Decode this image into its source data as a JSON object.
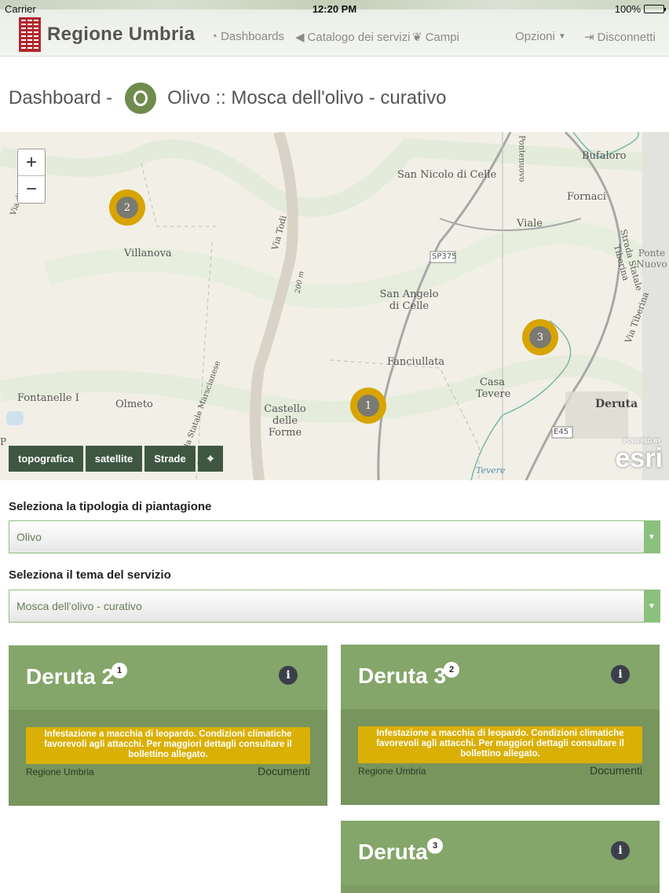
{
  "status_bar": {
    "carrier": "Carrier",
    "time": "12:20 PM",
    "battery": "100%"
  },
  "nav": {
    "brand": "Regione Umbria",
    "items": [
      {
        "label": "Dashboards",
        "icon": "dashboard-icon"
      },
      {
        "label": "Catalogo dei servizi",
        "icon": "megaphone-icon"
      },
      {
        "label": "Campi",
        "icon": "leaf-icon"
      },
      {
        "label": "Opzioni",
        "icon": "chevron-down-icon"
      },
      {
        "label": "Disconnetti",
        "icon": "logout-icon"
      }
    ]
  },
  "page": {
    "title_prefix": "Dashboard -",
    "title_main": "Olivo :: Mosca dell'olivo - curativo"
  },
  "map": {
    "zoom_in": "+",
    "zoom_out": "−",
    "labels": [
      "San Nicolo di Celle",
      "Bufaloro",
      "Fornaci",
      "Viale",
      "Villanova",
      "San Angelo di Celle",
      "Fanciullata",
      "Casa Tevere",
      "Deruta",
      "Fontanelle I",
      "Olmeto",
      "Castello delle Forme",
      "Via Todi",
      "SP375",
      "E45",
      "Tevere",
      "Strada Statale Tiberina",
      "Ponte Nuovo",
      "Pontenuovo",
      "Strada Statale Marscianese",
      "200 m",
      "Via Tiberina",
      "Via di Pila",
      "P"
    ],
    "markers": [
      "2",
      "1",
      "3"
    ],
    "buttons": [
      "topografica",
      "satellite",
      "Strade",
      "⌖"
    ],
    "attribution_small": "POWERED BY",
    "attribution": "esri"
  },
  "form": {
    "plantation_label": "Seleziona la tipologia di piantagione",
    "plantation_value": "Olivo",
    "service_label": "Seleziona il tema del servizio",
    "service_value": "Mosca dell'olivo - curativo"
  },
  "cards": [
    {
      "title": "Deruta 2",
      "count": "1",
      "alert": "Infestazione a macchia di leopardo. Condizioni climatiche favorevoli agli attacchi. Per maggiori dettagli consultare il bollettino allegato.",
      "source": "Regione Umbria",
      "docs": "Documenti"
    },
    {
      "title": "Deruta 3",
      "count": "2",
      "alert": "Infestazione a macchia di leopardo. Condizioni climatiche favorevoli agli attacchi. Per maggiori dettagli consultare il bollettino allegato.",
      "source": "Regione Umbria",
      "docs": "Documenti"
    },
    {
      "title": "Deruta",
      "count": "3"
    }
  ],
  "colors": {
    "accent": "#7e9d65",
    "marker": "#d8a400",
    "alert": "#dab006",
    "map_button": "#3f5741"
  }
}
